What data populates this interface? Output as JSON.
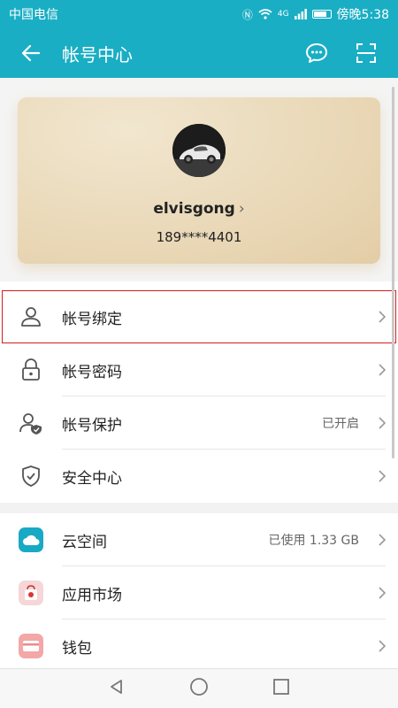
{
  "status_bar": {
    "carrier": "中国电信",
    "network": "4G",
    "time": "傍晚5:38"
  },
  "app_bar": {
    "title": "帐号中心"
  },
  "profile": {
    "username": "elvisgong",
    "phone": "189****4401"
  },
  "account_items": [
    {
      "label": "帐号绑定",
      "value": ""
    },
    {
      "label": "帐号密码",
      "value": ""
    },
    {
      "label": "帐号保护",
      "value": "已开启"
    },
    {
      "label": "安全中心",
      "value": ""
    }
  ],
  "service_items": [
    {
      "label": "云空间",
      "value": "已使用 1.33 GB"
    },
    {
      "label": "应用市场",
      "value": ""
    },
    {
      "label": "钱包",
      "value": ""
    }
  ],
  "colors": {
    "accent": "#1aaec4",
    "highlight": "#d21e1e"
  }
}
